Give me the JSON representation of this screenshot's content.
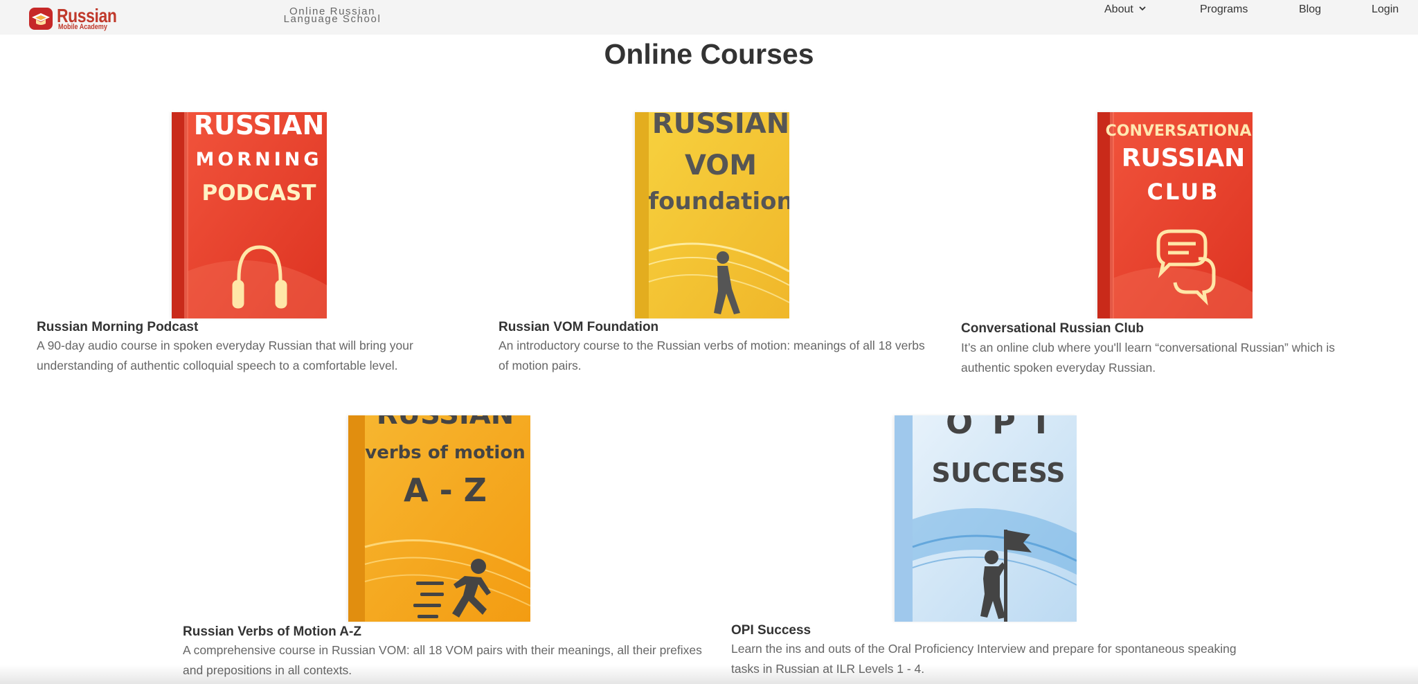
{
  "header": {
    "logo_name": "Russian",
    "logo_sub": "Mobile Academy",
    "tagline_line1": "Online Russian",
    "tagline_line2": "Language School",
    "nav": {
      "about": "About",
      "programs": "Programs",
      "blog": "Blog",
      "login": "Login"
    }
  },
  "page_title": "Online Courses",
  "courses": [
    {
      "title": "Russian Morning Podcast",
      "description": "A 90-day audio course in spoken everyday Russian that will bring your understanding of authentic colloquial speech to a comfortable level.",
      "cover": {
        "line1": "RUSSIAN",
        "line2": "MORNING",
        "line3": "PODCAST",
        "color": "#e8422e",
        "icon": "headphones-icon"
      }
    },
    {
      "title": "Russian VOM Foundation",
      "description": "An introductory course to the Russian verbs of motion: meanings of all 18 verbs of motion pairs.",
      "cover": {
        "line1": "RUSSIAN",
        "line2": "VOM",
        "line3": "foundation",
        "color": "#f2c229",
        "icon": "walking-person-icon"
      }
    },
    {
      "title": "Conversational Russian Club",
      "description": "It’s an online club where you'll learn “conversational Russian” which is authentic spoken everyday Russian.",
      "cover": {
        "line1": "CONVERSATIONAL",
        "line2": "RUSSIAN",
        "line3": "CLUB",
        "color": "#e8422e",
        "icon": "chat-bubbles-icon"
      }
    },
    {
      "title": "Russian Verbs of Motion A-Z",
      "description": "A comprehensive course in Russian VOM: all 18 VOM pairs with their meanings, all their prefixes and prepositions in all contexts.",
      "cover": {
        "line1": "RUSSIAN",
        "line2": "verbs of motion",
        "line3": "A - Z",
        "color": "#f5a623",
        "icon": "running-person-icon"
      }
    },
    {
      "title": "OPI Success",
      "description": "Learn the ins and outs of the Oral Proficiency Interview and prepare for spontaneous speaking tasks in Russian at ILR Levels 1 - 4.",
      "cover": {
        "line1": "O P I",
        "line2": "SUCCESS",
        "color": "#5aa6df",
        "icon": "flag-climber-icon"
      }
    }
  ],
  "colors": {
    "brand_red": "#c0392b",
    "topbar_bg": "#f4f4f4",
    "text": "#333333",
    "muted_text": "#666666"
  }
}
